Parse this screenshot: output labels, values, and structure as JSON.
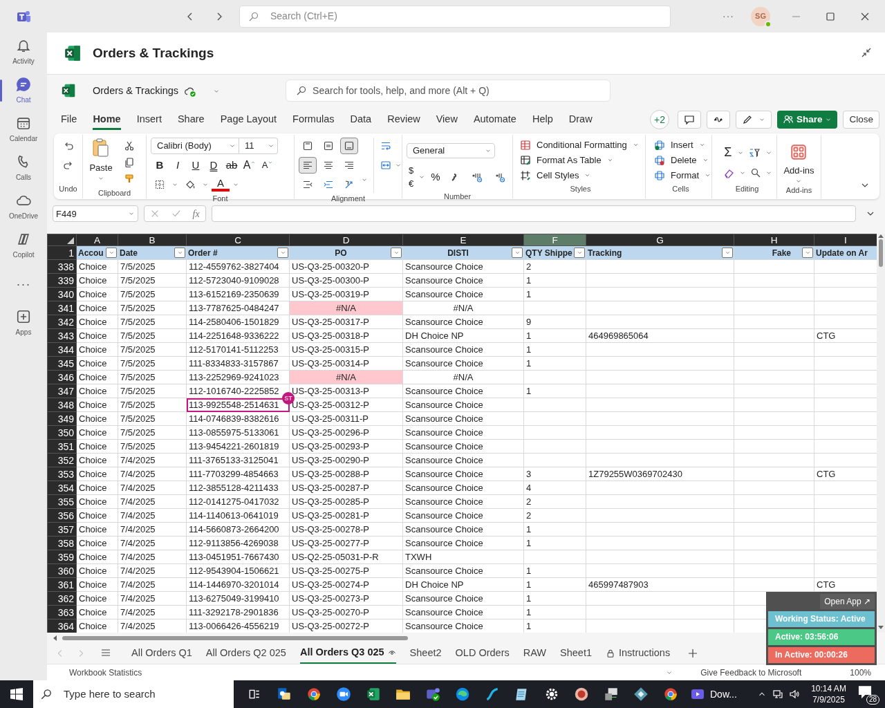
{
  "titlebar": {
    "search_placeholder": "Search (Ctrl+E)",
    "more": "···",
    "avatar": "SG"
  },
  "rail": [
    {
      "label": "Activity",
      "kind": "bell",
      "selected": false
    },
    {
      "label": "Chat",
      "kind": "chat",
      "selected": true
    },
    {
      "label": "Calendar",
      "kind": "calendar",
      "selected": false
    },
    {
      "label": "Calls",
      "kind": "phone",
      "selected": false
    },
    {
      "label": "OneDrive",
      "kind": "cloud",
      "selected": false
    },
    {
      "label": "Copilot",
      "kind": "copilot",
      "selected": false
    },
    {
      "label": "···",
      "kind": "more",
      "selected": false
    },
    {
      "label": "Apps",
      "kind": "apps",
      "selected": false
    }
  ],
  "app_header": {
    "title": "Orders & Trackings"
  },
  "workbook": {
    "name": "Orders & Trackings",
    "search_placeholder": "Search for tools, help, and more (Alt + Q)"
  },
  "menu_tabs": [
    {
      "label": "File",
      "selected": false
    },
    {
      "label": "Home",
      "selected": true
    },
    {
      "label": "Insert",
      "selected": false
    },
    {
      "label": "Share",
      "selected": false
    },
    {
      "label": "Page Layout",
      "selected": false
    },
    {
      "label": "Formulas",
      "selected": false
    },
    {
      "label": "Data",
      "selected": false
    },
    {
      "label": "Review",
      "selected": false
    },
    {
      "label": "View",
      "selected": false
    },
    {
      "label": "Automate",
      "selected": false
    },
    {
      "label": "Help",
      "selected": false
    },
    {
      "label": "Draw",
      "selected": false
    }
  ],
  "collaborators": "+2",
  "share_button": "Share",
  "close_button": "Close",
  "ribbon": {
    "undo": {
      "label": "Undo"
    },
    "clipboard": {
      "label": "Clipboard",
      "paste": "Paste"
    },
    "font": {
      "label": "Font",
      "family": "Calibri (Body)",
      "size": "11",
      "font_color": "A",
      "buttons": [
        {
          "kind": "bold",
          "text": "B"
        },
        {
          "kind": "italic",
          "text": "I"
        },
        {
          "kind": "underline",
          "text": "U"
        },
        {
          "kind": "double-underline",
          "text": "D"
        },
        {
          "kind": "strike",
          "text": "ab"
        },
        {
          "kind": "grow",
          "text": "A"
        },
        {
          "kind": "shrink",
          "text": "A"
        }
      ]
    },
    "alignment": {
      "label": "Alignment",
      "vertical": [
        {
          "kind": "top",
          "on": false
        },
        {
          "kind": "middle",
          "on": false
        },
        {
          "kind": "bottom",
          "on": true
        }
      ],
      "horizontal": [
        {
          "kind": "left",
          "on": true
        },
        {
          "kind": "center",
          "on": false
        },
        {
          "kind": "right",
          "on": false
        }
      ]
    },
    "number": {
      "label": "Number",
      "format": "General",
      "currency": "$€",
      "percent": "%"
    },
    "styles": {
      "label": "Styles",
      "items": [
        "Conditional Formatting",
        "Format As Table",
        "Cell Styles"
      ]
    },
    "cells": {
      "label": "Cells",
      "items": [
        "Insert",
        "Delete",
        "Format"
      ]
    },
    "editing": {
      "label": "Editing",
      "sum": "Σ"
    },
    "addins": {
      "label": "Add-ins",
      "button": "Add-ins"
    }
  },
  "formula_bar": {
    "name_box": "F449",
    "fx": "fx"
  },
  "sheet": {
    "header_row": "1",
    "columns": [
      {
        "letter": "A",
        "header": "Accou",
        "selected": false,
        "filter": true
      },
      {
        "letter": "B",
        "header": "Date",
        "selected": false,
        "filter": true
      },
      {
        "letter": "C",
        "header": "Order #",
        "selected": false,
        "filter": true
      },
      {
        "letter": "D",
        "header": "PO",
        "selected": false,
        "filter": true
      },
      {
        "letter": "E",
        "header": "DISTI",
        "selected": false,
        "filter": true
      },
      {
        "letter": "F",
        "header": "QTY Shippe",
        "selected": true,
        "filter": true
      },
      {
        "letter": "G",
        "header": "Tracking",
        "selected": false,
        "filter": true
      },
      {
        "letter": "H",
        "header": "Fake",
        "selected": false,
        "filter": true
      },
      {
        "letter": "I",
        "header": "Update on Ar",
        "selected": false,
        "filter": false
      }
    ],
    "rows": [
      {
        "n": "338",
        "account": "Choice",
        "date": "7/5/2025",
        "order": "112-4559762-3827404",
        "po": "US-Q3-25-00320-P",
        "disti": "Scansource Choice",
        "qty": "2",
        "po_error": false
      },
      {
        "n": "339",
        "account": "Choice",
        "date": "7/5/2025",
        "order": "112-5723040-9109028",
        "po": "US-Q3-25-00300-P",
        "disti": "Scansource Choice",
        "qty": "1",
        "po_error": false
      },
      {
        "n": "340",
        "account": "Choice",
        "date": "7/5/2025",
        "order": "113-6152169-2350639",
        "po": "US-Q3-25-00319-P",
        "disti": "Scansource Choice",
        "qty": "1",
        "po_error": false
      },
      {
        "n": "341",
        "account": "Choice",
        "date": "7/5/2025",
        "order": "113-7787625-0484247",
        "po": "#N/A",
        "disti": "#N/A",
        "po_error": true
      },
      {
        "n": "342",
        "account": "Choice",
        "date": "7/5/2025",
        "order": "114-2580406-1501829",
        "po": "US-Q3-25-00317-P",
        "disti": "Scansource Choice",
        "qty": "9",
        "po_error": false
      },
      {
        "n": "343",
        "account": "Choice",
        "date": "7/5/2025",
        "order": "114-2251648-9336222",
        "po": "US-Q3-25-00318-P",
        "disti": "DH Choice NP",
        "qty": "1",
        "tracking": "464969865064",
        "update": "CTG",
        "po_error": false
      },
      {
        "n": "344",
        "account": "Choice",
        "date": "7/5/2025",
        "order": "112-5170141-5112253",
        "po": "US-Q3-25-00315-P",
        "disti": "Scansource Choice",
        "qty": "1",
        "po_error": false
      },
      {
        "n": "345",
        "account": "Choice",
        "date": "7/5/2025",
        "order": "111-8334833-3157867",
        "po": "US-Q3-25-00314-P",
        "disti": "Scansource Choice",
        "qty": "1",
        "po_error": false
      },
      {
        "n": "346",
        "account": "Choice",
        "date": "7/5/2025",
        "order": "113-2252969-9241023",
        "po": "#N/A",
        "disti": "#N/A",
        "po_error": true
      },
      {
        "n": "347",
        "account": "Choice",
        "date": "7/5/2025",
        "order": "112-1016740-2225852",
        "po": "US-Q3-25-00313-P",
        "disti": "Scansource Choice",
        "qty": "1",
        "po_error": false
      },
      {
        "n": "348",
        "account": "Choice",
        "date": "7/5/2025",
        "order": "113-9925548-2514631",
        "po": "US-Q3-25-00312-P",
        "disti": "Scansource Choice",
        "po_error": false,
        "cursor": "ST"
      },
      {
        "n": "349",
        "account": "Choice",
        "date": "7/5/2025",
        "order": "114-0746839-8382616",
        "po": "US-Q3-25-00311-P",
        "disti": "Scansource Choice",
        "po_error": false
      },
      {
        "n": "350",
        "account": "Choice",
        "date": "7/5/2025",
        "order": "113-0855975-5133061",
        "po": "US-Q3-25-00296-P",
        "disti": "Scansource Choice",
        "po_error": false
      },
      {
        "n": "351",
        "account": "Choice",
        "date": "7/5/2025",
        "order": "113-9454221-2601819",
        "po": "US-Q3-25-00293-P",
        "disti": "Scansource Choice",
        "po_error": false
      },
      {
        "n": "352",
        "account": "Choice",
        "date": "7/4/2025",
        "order": "111-3765133-3125041",
        "po": "US-Q3-25-00290-P",
        "disti": "Scansource Choice",
        "po_error": false
      },
      {
        "n": "353",
        "account": "Choice",
        "date": "7/4/2025",
        "order": "111-7703299-4854663",
        "po": "US-Q3-25-00288-P",
        "disti": "Scansource Choice",
        "qty": "3",
        "tracking": "1Z79255W0369702430",
        "update": "CTG",
        "po_error": false
      },
      {
        "n": "354",
        "account": "Choice",
        "date": "7/4/2025",
        "order": "112-3855128-4211433",
        "po": "US-Q3-25-00287-P",
        "disti": "Scansource Choice",
        "qty": "4",
        "po_error": false
      },
      {
        "n": "355",
        "account": "Choice",
        "date": "7/4/2025",
        "order": "112-0141275-0417032",
        "po": "US-Q3-25-00285-P",
        "disti": "Scansource Choice",
        "qty": "2",
        "po_error": false
      },
      {
        "n": "356",
        "account": "Choice",
        "date": "7/4/2025",
        "order": "114-1140613-0641019",
        "po": "US-Q3-25-00281-P",
        "disti": "Scansource Choice",
        "qty": "2",
        "po_error": false
      },
      {
        "n": "357",
        "account": "Choice",
        "date": "7/4/2025",
        "order": "114-5660873-2664200",
        "po": "US-Q3-25-00278-P",
        "disti": "Scansource Choice",
        "qty": "1",
        "po_error": false
      },
      {
        "n": "358",
        "account": "Choice",
        "date": "7/4/2025",
        "order": "112-9113856-4269038",
        "po": "US-Q3-25-00277-P",
        "disti": "Scansource Choice",
        "qty": "1",
        "po_error": false
      },
      {
        "n": "359",
        "account": "Choice",
        "date": "7/4/2025",
        "order": "113-0451951-7667430",
        "po": "US-Q2-25-05031-P-R",
        "disti": "TXWH",
        "po_error": false
      },
      {
        "n": "360",
        "account": "Choice",
        "date": "7/4/2025",
        "order": "112-9543904-1506621",
        "po": "US-Q3-25-00275-P",
        "disti": "Scansource Choice",
        "qty": "1",
        "po_error": false
      },
      {
        "n": "361",
        "account": "Choice",
        "date": "7/4/2025",
        "order": "114-1446970-3201014",
        "po": "US-Q3-25-00274-P",
        "disti": "DH Choice NP",
        "qty": "1",
        "tracking": "465997487903",
        "update": "CTG",
        "po_error": false
      },
      {
        "n": "362",
        "account": "Choice",
        "date": "7/4/2025",
        "order": "113-6275049-3199410",
        "po": "US-Q3-25-00273-P",
        "disti": "Scansource Choice",
        "qty": "1",
        "po_error": false
      },
      {
        "n": "363",
        "account": "Choice",
        "date": "7/4/2025",
        "order": "111-3292178-2901836",
        "po": "US-Q3-25-00270-P",
        "disti": "Scansource Choice",
        "qty": "1",
        "po_error": false
      },
      {
        "n": "364",
        "account": "Choice",
        "date": "7/4/2025",
        "order": "113-0066426-4556219",
        "po": "US-Q3-25-00272-P",
        "disti": "Scansource Choice",
        "qty": "1",
        "po_error": false
      }
    ]
  },
  "sheet_tabs": [
    {
      "label": "All Orders Q1",
      "kind": "plain",
      "selected": false
    },
    {
      "label": "All Orders Q2 025",
      "kind": "plain",
      "selected": false
    },
    {
      "label": "All Orders Q3 025",
      "kind": "viewed",
      "selected": true
    },
    {
      "label": "Sheet2",
      "kind": "plain",
      "selected": false
    },
    {
      "label": "OLD Orders",
      "kind": "plain",
      "selected": false
    },
    {
      "label": "RAW",
      "kind": "plain",
      "selected": false
    },
    {
      "label": "Sheet1",
      "kind": "plain",
      "selected": false
    },
    {
      "label": "Instructions",
      "kind": "locked",
      "selected": false
    }
  ],
  "status_bar": {
    "statistics": "Workbook Statistics",
    "feedback": "Give Feedback to Microsoft",
    "zoom": "100%"
  },
  "tracker": {
    "open_app": "Open App ↗",
    "items": [
      {
        "label": "Working Status: Active",
        "color": "#6cc0d0"
      },
      {
        "label": "Active: 03:56:06",
        "color": "#4cc886"
      },
      {
        "label": "In Active: 00:00:26",
        "color": "#ec6a5e"
      }
    ]
  },
  "taskbar": {
    "search_placeholder": "Type here to search",
    "apps": [
      {
        "kind": "mail"
      },
      {
        "kind": "chrome"
      },
      {
        "kind": "zoom"
      },
      {
        "kind": "excel"
      },
      {
        "kind": "folder"
      },
      {
        "kind": "teams"
      },
      {
        "kind": "edge"
      },
      {
        "kind": "s"
      },
      {
        "kind": "notepad"
      },
      {
        "kind": "gear"
      },
      {
        "kind": "seal"
      },
      {
        "kind": "monitor"
      },
      {
        "kind": "diamond"
      },
      {
        "kind": "chrome"
      }
    ],
    "running": "Dow...",
    "time": "10:14 AM",
    "date": "7/9/2025",
    "notifications": "28"
  }
}
